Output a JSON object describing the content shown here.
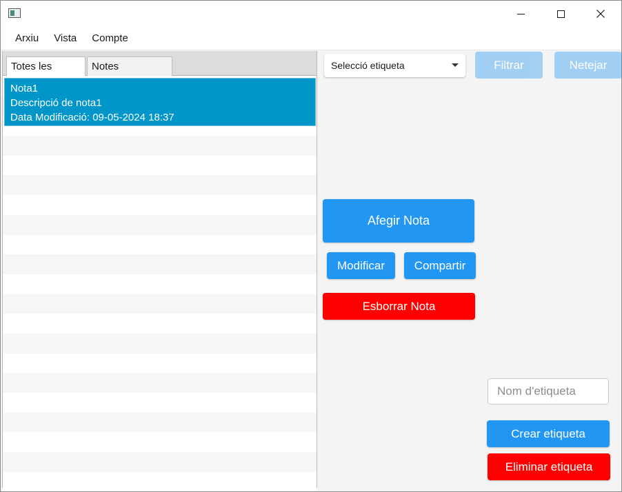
{
  "menu": {
    "items": [
      "Arxiu",
      "Vista",
      "Compte"
    ]
  },
  "tabs": [
    "Totes les Notes",
    "Notes preferides"
  ],
  "notes": [
    {
      "title": "Nota1",
      "description": "Descripció de nota1",
      "modified": "Data Modificació: 09-05-2024 18:37"
    }
  ],
  "filter": {
    "tag_select": "Selecció etiqueta",
    "filter_label": "Filtrar",
    "clear_label": "Netejar"
  },
  "actions": {
    "add_label": "Afegir Nota",
    "modify_label": "Modificar",
    "share_label": "Compartir",
    "delete_label": "Esborrar Nota"
  },
  "tags": {
    "name_placeholder": "Nom d'etiqueta",
    "create_label": "Crear etiqueta",
    "delete_label": "Eliminar etiqueta"
  },
  "colors": {
    "primary": "#2196f3",
    "danger": "#ff0000",
    "selection": "#0096c9",
    "disabled": "#99ccf4"
  }
}
